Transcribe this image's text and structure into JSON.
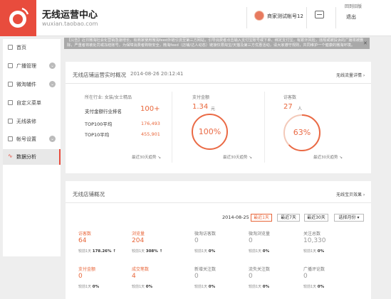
{
  "header": {
    "app_title": "无线运营中心",
    "app_domain": "wuxian.taobao.com",
    "account_name": "商家测试帐号12",
    "logout_label": "退出",
    "back_old_label": "回到旧版"
  },
  "sidebar": {
    "items": [
      {
        "label": "首页",
        "icon": "home-icon",
        "has_chevron": false
      },
      {
        "label": "广播管理",
        "icon": "broadcast-icon",
        "has_chevron": true
      },
      {
        "label": "微淘辅件",
        "icon": "widget-icon",
        "has_chevron": true
      },
      {
        "label": "自定义菜单",
        "icon": "menu-icon",
        "has_chevron": false
      },
      {
        "label": "无线装修",
        "icon": "decorate-icon",
        "has_chevron": false
      },
      {
        "label": "帐号设置",
        "icon": "settings-icon",
        "has_chevron": true
      },
      {
        "label": "数据分析",
        "icon": "analytics-icon",
        "has_chevron": false,
        "active": true
      }
    ]
  },
  "notice": {
    "text": "【公告】近日微淘社会化营销急速增长，有商家使用微淘feed外链引流至第三方网站，引导消费者点击输入支付宝账号或下单、绑定支付宝，有欺诈风险，违规或被投诉的广播将被删除，严重者将被处罚或冻结账号，为保障消费者购物安全，微淘feed（店铺/达人动态）链接仅限淘宝/天猫及第三方优惠活动，请大家遵守规则，共同维护一个健康的微淘环境。",
    "close_label": "✕"
  },
  "realtime": {
    "title": "无线店铺运营实时概况",
    "timestamp": "2014-08-26 20:12:41",
    "detail_link": "无线流量详情 ›",
    "industry_label": "所在行业: 女装/女士精品",
    "pay_rank_label": "支付金额行业排名",
    "pay_rank_value": "100+",
    "top100_label": "TOP100平均",
    "top100_value": "176,493",
    "top10_label": "TOP10平均",
    "top10_value": "455,901",
    "trend_label_1": "最近30天趋势 ↘",
    "pay_amount_label": "支付金额",
    "pay_amount_value": "1.34",
    "pay_amount_unit": "元",
    "pay_ring_pct": "100%",
    "pay_ring_fraction": 1.0,
    "trend_label_2": "最近30天趋势 ↘",
    "visitors_label": "访客数",
    "visitors_value": "27",
    "visitors_unit": "人",
    "visitors_ring_pct": "63%",
    "visitors_ring_fraction": 0.63,
    "trend_label_3": "最近30天趋势 ↘"
  },
  "overview": {
    "title": "无线店铺概况",
    "effect_link": "无线宝贝效果 ›",
    "date": "2014-08-25",
    "range_buttons": [
      "最近1天",
      "最近7天",
      "最近30天"
    ],
    "active_range": "最近1天",
    "month_select": "选择月份 ▾",
    "compare_prefix": "较前1天",
    "metrics_row1": [
      {
        "label": "访客数",
        "value": "64",
        "change": "178.26% ↑",
        "highlight": true
      },
      {
        "label": "浏览量",
        "value": "204",
        "change": "308% ↑",
        "highlight": true
      },
      {
        "label": "微淘访客数",
        "value": "0",
        "change": "0%",
        "highlight": false
      },
      {
        "label": "微淘浏览量",
        "value": "0",
        "change": "0%",
        "highlight": false
      },
      {
        "label": "关注总数",
        "value": "10,330",
        "change": "0%",
        "highlight": false
      }
    ],
    "metrics_row2": [
      {
        "label": "支付金额",
        "value": "0",
        "change": "0%",
        "highlight": true
      },
      {
        "label": "成交笔数",
        "value": "4",
        "change": "0%",
        "highlight": true
      },
      {
        "label": "新增关注数",
        "value": "0",
        "change": "0%",
        "highlight": false
      },
      {
        "label": "流失关注数",
        "value": "0",
        "change": "0%",
        "highlight": false
      },
      {
        "label": "广播评论数",
        "value": "0",
        "change": "0%",
        "highlight": false
      }
    ]
  }
}
